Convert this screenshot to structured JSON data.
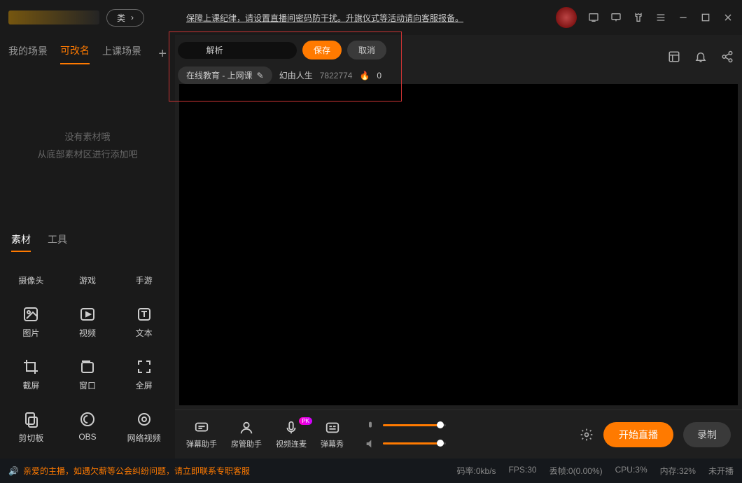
{
  "titlebar": {
    "pill_label": "类",
    "notice": "保障上课纪律，请设置直播间密码防干扰。升旗仪式等活动请向客服报备。"
  },
  "tabs": {
    "t1": "我的场景",
    "t2": "可改名",
    "t3": "上课场景"
  },
  "empty": {
    "l1": "没有素材哦",
    "l2": "从底部素材区进行添加吧"
  },
  "tooltabs": {
    "t1": "素材",
    "t2": "工具"
  },
  "grid": {
    "c1": "摄像头",
    "c2": "游戏",
    "c3": "手游",
    "c4": "图片",
    "c5": "视频",
    "c6": "文本",
    "c7": "截屏",
    "c8": "窗口",
    "c9": "全屏",
    "c10": "剪切板",
    "c11": "OBS",
    "c12": "网络视频"
  },
  "edit": {
    "input": "        解析",
    "save": "保存",
    "cancel": "取消",
    "cat": "在线教育 - 上网课",
    "user": "幻由人生",
    "id": "7822774",
    "heat": "0"
  },
  "bottom": {
    "b1": "弹幕助手",
    "b2": "房管助手",
    "b3": "视频连麦",
    "b4": "弹幕秀",
    "start": "开始直播",
    "rec": "录制",
    "pk": "PK"
  },
  "status": {
    "msg": "亲爱的主播，如遇欠薪等公会纠纷问题，请立即联系专职客服",
    "bitrate": "码率:0kb/s",
    "fps": "FPS:30",
    "drop": "丢帧:0(0.00%)",
    "cpu": "CPU:3%",
    "mem": "内存:32%",
    "state": "未开播"
  }
}
